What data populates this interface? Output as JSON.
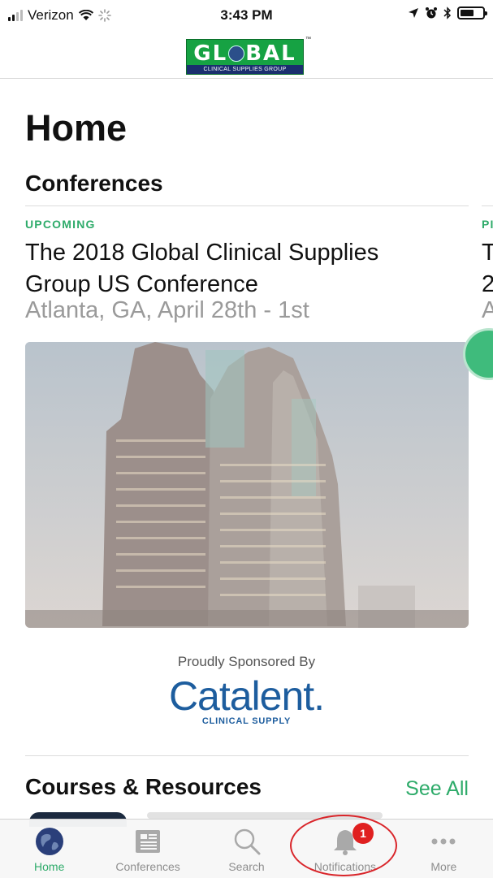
{
  "status_bar": {
    "carrier": "Verizon",
    "time": "3:43 PM",
    "icons": [
      "signal-icon",
      "wifi-icon",
      "loading-icon",
      "location-icon",
      "alarm-icon",
      "bluetooth-icon",
      "battery-icon"
    ],
    "battery_level": 0.6
  },
  "header": {
    "logo_word": "GL  BAL",
    "logo_sub": "CLINICAL SUPPLIES GROUP",
    "logo_tm": "™"
  },
  "page": {
    "title": "Home"
  },
  "conferences": {
    "title": "Conferences",
    "card": {
      "status": "UPCOMING",
      "title": "The 2018 Global Clinical Supplies Group US Conference",
      "subtitle": "Atlanta, GA, April 28th - 1st"
    },
    "next_card_peek": {
      "status": "PI",
      "title_start": "T\n2",
      "subtitle_start": "A"
    }
  },
  "sponsor": {
    "label": "Proudly Sponsored By",
    "name": "Catalent.",
    "sub": "CLINICAL SUPPLY"
  },
  "courses": {
    "title": "Courses & Resources",
    "see_all": "See All"
  },
  "tabs": [
    {
      "label": "Home",
      "icon": "globe-icon",
      "active": true
    },
    {
      "label": "Conferences",
      "icon": "newspaper-icon",
      "active": false
    },
    {
      "label": "Search",
      "icon": "search-icon",
      "active": false
    },
    {
      "label": "Notifications",
      "icon": "bell-icon",
      "active": false,
      "badge": "1"
    },
    {
      "label": "More",
      "icon": "more-icon",
      "active": false
    }
  ],
  "colors": {
    "accent": "#2eab6a",
    "badge": "#e02020",
    "sponsor": "#1d5d9e",
    "annotation": "#d9252a"
  }
}
